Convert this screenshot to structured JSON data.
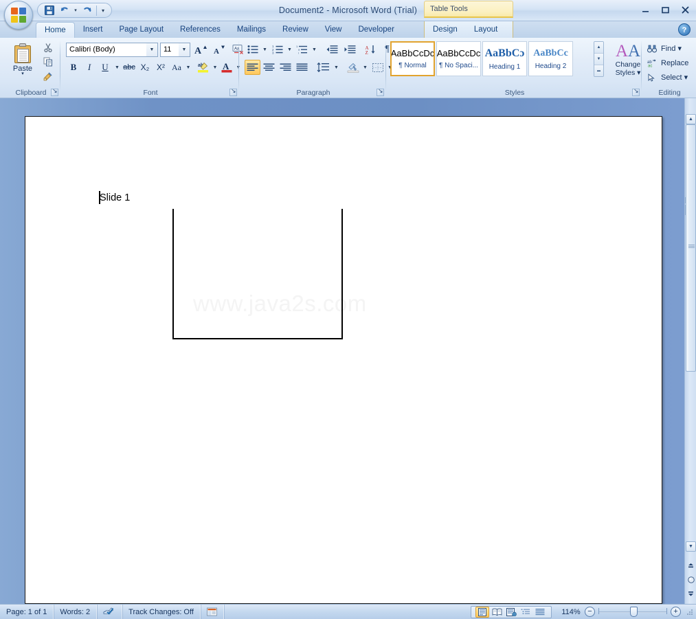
{
  "window": {
    "title": "Document2 - Microsoft Word (Trial)",
    "minimize": "–",
    "maximize": "▭",
    "close": "✕"
  },
  "quick_access": {
    "save": "save-icon",
    "undo": "↰",
    "undo_caret": "▾",
    "redo": "↷",
    "customize": "▾"
  },
  "contextual": {
    "title": "Table Tools",
    "tabs": [
      "Design",
      "Layout"
    ]
  },
  "tabs": [
    {
      "label": "Home",
      "active": true
    },
    {
      "label": "Insert",
      "active": false
    },
    {
      "label": "Page Layout",
      "active": false
    },
    {
      "label": "References",
      "active": false
    },
    {
      "label": "Mailings",
      "active": false
    },
    {
      "label": "Review",
      "active": false
    },
    {
      "label": "View",
      "active": false
    },
    {
      "label": "Developer",
      "active": false
    }
  ],
  "help": "?",
  "ribbon": {
    "clipboard": {
      "label": "Clipboard",
      "paste": "Paste",
      "paste_caret": "▾",
      "cut": "Cut",
      "copy": "Copy",
      "format_painter": "Format Painter"
    },
    "font": {
      "label": "Font",
      "font_name": "Calibri (Body)",
      "font_size": "11",
      "grow_font": "A",
      "shrink_font": "A",
      "clear_formatting": "Clear Formatting",
      "bold": "B",
      "italic": "I",
      "underline": "U",
      "strikethrough": "abc",
      "subscript": "X₂",
      "superscript": "X²",
      "change_case": "Aa",
      "highlight": "ab",
      "font_color": "A"
    },
    "paragraph": {
      "label": "Paragraph",
      "bullets": "Bullets",
      "numbering": "Numbering",
      "multilevel": "Multilevel List",
      "decrease_indent": "Decrease Indent",
      "increase_indent": "Increase Indent",
      "sort": "Sort",
      "show_marks": "¶",
      "align_left": "Align Left",
      "align_center": "Center",
      "align_right": "Align Right",
      "justify": "Justify",
      "line_spacing": "Line Spacing",
      "shading": "Shading",
      "borders": "Borders"
    },
    "styles": {
      "label": "Styles",
      "items": [
        {
          "sample": "AaBbCcDc",
          "name": "¶ Normal",
          "selected": true
        },
        {
          "sample": "AaBbCcDc",
          "name": "¶ No Spaci...",
          "selected": false
        },
        {
          "sample": "AaBbCɔ",
          "name": "Heading 1",
          "selected": false
        },
        {
          "sample": "AaBbCc",
          "name": "Heading 2",
          "selected": false
        }
      ],
      "scroll_up": "▲",
      "scroll_down": "▼",
      "scroll_more": "▤",
      "change_styles_line1": "Change",
      "change_styles_line2": "Styles ▾"
    },
    "editing": {
      "label": "Editing",
      "find": "Find ▾",
      "replace": "Replace",
      "select": "Select ▾"
    }
  },
  "document": {
    "body_text": "Slide 1",
    "watermark": "www.java2s.com"
  },
  "scrollbar": {
    "up": "▲",
    "down": "▼",
    "previous_page": "▲",
    "browse_object": "◉",
    "next_page": "▼",
    "split": "split-bar",
    "ruler_toggle": "ruler-icon"
  },
  "status": {
    "page": "Page: 1 of 1",
    "words": "Words: 2",
    "proofing": "proofing-icon",
    "track_changes": "Track Changes: Off",
    "macro": "macro-icon",
    "views": [
      {
        "name": "print-layout",
        "selected": true
      },
      {
        "name": "full-screen-reading",
        "selected": false
      },
      {
        "name": "web-layout",
        "selected": false
      },
      {
        "name": "outline",
        "selected": false
      },
      {
        "name": "draft",
        "selected": false
      }
    ],
    "zoom": "114%",
    "zoom_out": "−",
    "zoom_in": "+"
  }
}
